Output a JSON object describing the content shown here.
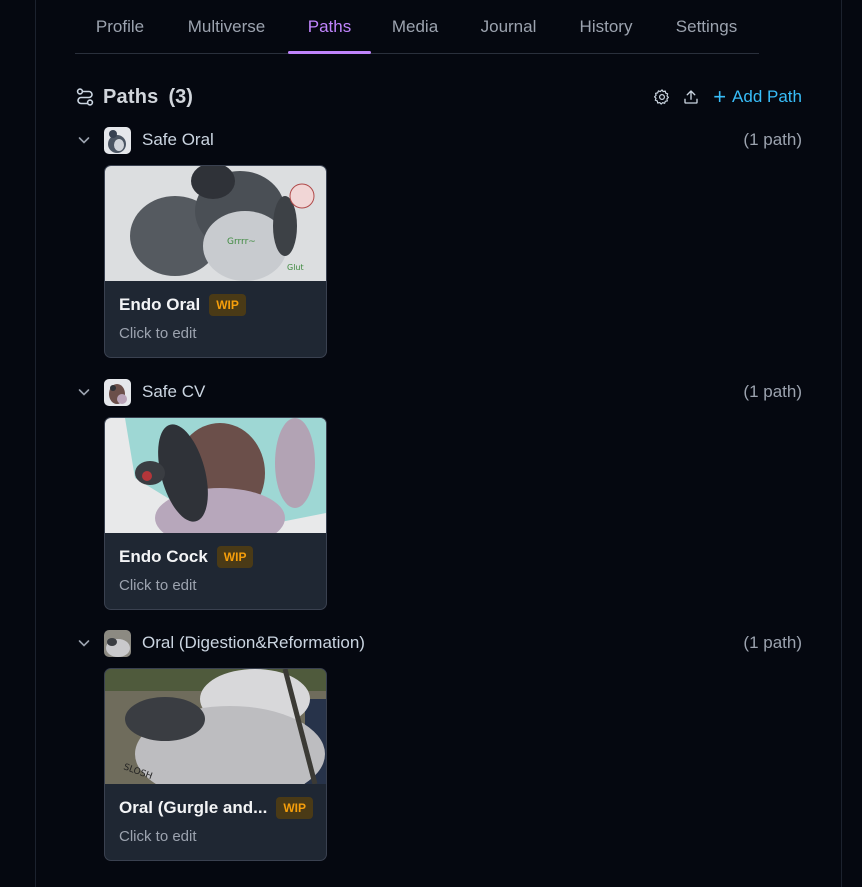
{
  "tabs": [
    {
      "label": "Profile"
    },
    {
      "label": "Multiverse"
    },
    {
      "label": "Paths"
    },
    {
      "label": "Media"
    },
    {
      "label": "Journal"
    },
    {
      "label": "History"
    },
    {
      "label": "Settings"
    }
  ],
  "active_tab": "Paths",
  "header": {
    "title": "Paths",
    "count": "(3)",
    "add_label": "Add Path",
    "icons": [
      "paths-icon",
      "gear-icon",
      "upload-icon",
      "plus-icon"
    ]
  },
  "groups": [
    {
      "name": "Safe Oral",
      "count": "(1 path)",
      "card": {
        "title": "Endo Oral",
        "badge": "WIP",
        "subtitle": "Click to edit"
      }
    },
    {
      "name": "Safe CV",
      "count": "(1 path)",
      "card": {
        "title": "Endo Cock",
        "badge": "WIP",
        "subtitle": "Click to edit"
      }
    },
    {
      "name": "Oral (Digestion&Reformation)",
      "count": "(1 path)",
      "card": {
        "title": "Oral (Gurgle and...",
        "badge": "WIP",
        "subtitle": "Click to edit"
      }
    }
  ],
  "colors": {
    "background": "#050810",
    "accent_active_tab": "#c084fc",
    "link": "#38bdf8",
    "wip_text": "#f59e0b",
    "wip_bg": "#4a3a16",
    "card_bg": "#1f2733"
  }
}
